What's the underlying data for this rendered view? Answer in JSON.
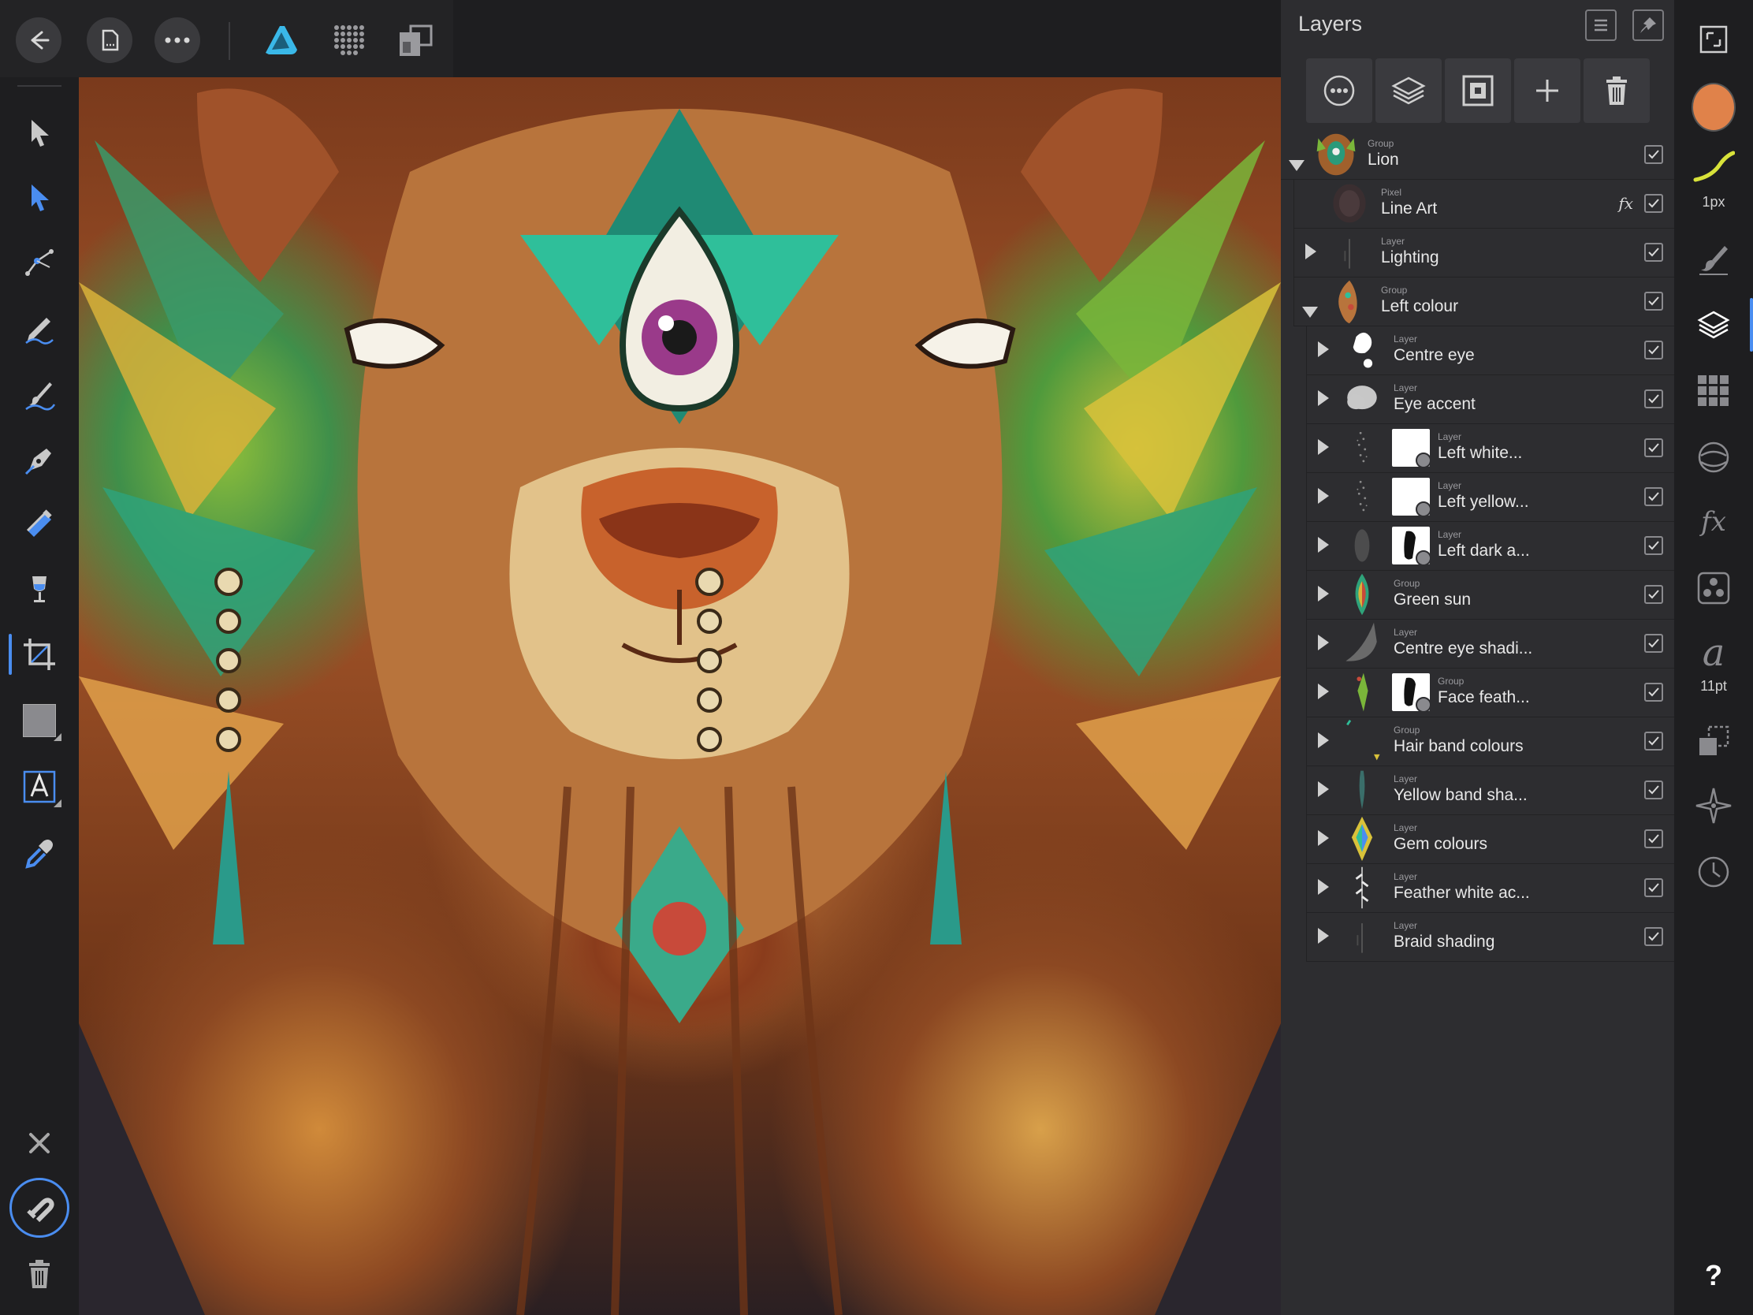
{
  "topbar": {
    "buttons": [
      {
        "name": "back-icon"
      },
      {
        "name": "document-icon"
      },
      {
        "name": "more-icon"
      },
      {
        "name": "designer-persona-icon"
      },
      {
        "name": "pixel-persona-icon"
      },
      {
        "name": "export-persona-icon"
      }
    ]
  },
  "tools": [
    {
      "name": "move-tool-icon"
    },
    {
      "name": "node-tool-icon"
    },
    {
      "name": "corner-tool-icon"
    },
    {
      "name": "pencil-tool-icon"
    },
    {
      "name": "vector-brush-tool-icon"
    },
    {
      "name": "pen-tool-icon"
    },
    {
      "name": "fill-tool-icon"
    },
    {
      "name": "transparency-tool-icon"
    },
    {
      "name": "crop-tool-icon"
    },
    {
      "name": "rectangle-tool-icon"
    },
    {
      "name": "artistic-text-tool-icon"
    },
    {
      "name": "color-picker-tool-icon"
    }
  ],
  "bottom_tools": [
    {
      "name": "close-icon"
    },
    {
      "name": "snapping-icon"
    },
    {
      "name": "delete-icon"
    }
  ],
  "layers_panel": {
    "title": "Layers",
    "toolbar": [
      {
        "name": "layer-options-icon"
      },
      {
        "name": "layer-stack-icon"
      },
      {
        "name": "mask-icon"
      },
      {
        "name": "add-layer-icon"
      },
      {
        "name": "delete-layer-icon"
      }
    ],
    "rows": [
      {
        "type": "Group",
        "name": "Lion",
        "expanded": true,
        "depth": 0,
        "thumb": "lion",
        "visible": true
      },
      {
        "type": "Pixel",
        "name": "Line Art",
        "depth": 1,
        "thumb": "lineart",
        "fx": "fx",
        "visible": true
      },
      {
        "type": "Layer",
        "name": "Lighting",
        "expanded": false,
        "depth": 1,
        "thumb": "faint",
        "visible": true,
        "accent": true
      },
      {
        "type": "Group",
        "name": "Left colour",
        "expanded": true,
        "depth": 1,
        "thumb": "colour",
        "visible": true
      },
      {
        "type": "Layer",
        "name": "Centre eye",
        "expanded": false,
        "depth": 2,
        "thumb": "whiteblob",
        "visible": true,
        "accent": true
      },
      {
        "type": "Layer",
        "name": "Eye accent",
        "expanded": false,
        "depth": 2,
        "thumb": "cloud",
        "visible": true
      },
      {
        "type": "Layer",
        "name": "Left white...",
        "expanded": false,
        "depth": 2,
        "thumb": "speckle",
        "mask": "white",
        "visible": true,
        "accent": true
      },
      {
        "type": "Layer",
        "name": "Left yellow...",
        "expanded": false,
        "depth": 2,
        "thumb": "speckle",
        "mask": "white",
        "visible": true
      },
      {
        "type": "Layer",
        "name": "Left dark a...",
        "expanded": false,
        "depth": 2,
        "thumb": "darkspeckle",
        "mask": "black",
        "visible": true
      },
      {
        "type": "Group",
        "name": "Green sun",
        "expanded": false,
        "depth": 2,
        "thumb": "greensun",
        "visible": true
      },
      {
        "type": "Layer",
        "name": "Centre eye shadi...",
        "expanded": false,
        "depth": 2,
        "thumb": "crescent",
        "visible": true,
        "accent": true
      },
      {
        "type": "Group",
        "name": "Face feath...",
        "expanded": false,
        "depth": 2,
        "thumb": "feather",
        "mask": "black",
        "visible": true
      },
      {
        "type": "Group",
        "name": "Hair band colours",
        "expanded": false,
        "depth": 2,
        "thumb": "bits",
        "visible": true
      },
      {
        "type": "Layer",
        "name": "Yellow band sha...",
        "expanded": false,
        "depth": 2,
        "thumb": "teal",
        "visible": true,
        "accent": true
      },
      {
        "type": "Layer",
        "name": "Gem colours",
        "expanded": false,
        "depth": 2,
        "thumb": "gems",
        "visible": true,
        "accent": true
      },
      {
        "type": "Layer",
        "name": "Feather white ac...",
        "expanded": false,
        "depth": 2,
        "thumb": "whitefeather",
        "visible": true,
        "accent": true
      },
      {
        "type": "Layer",
        "name": "Braid shading",
        "expanded": false,
        "depth": 2,
        "thumb": "faint",
        "visible": true,
        "accent": true
      }
    ]
  },
  "studio": {
    "brush_size": "1px",
    "font_size": "11pt",
    "color": "#e0824a",
    "help": "?",
    "icons": [
      {
        "name": "fullscreen-icon"
      },
      {
        "name": "color-swatch-icon"
      },
      {
        "name": "stroke-icon"
      },
      {
        "name": "brushes-icon"
      },
      {
        "name": "layers-icon"
      },
      {
        "name": "swatches-icon"
      },
      {
        "name": "appearance-icon"
      },
      {
        "name": "effects-icon"
      },
      {
        "name": "styles-icon"
      },
      {
        "name": "text-styles-icon"
      },
      {
        "name": "transform-icon"
      },
      {
        "name": "navigator-icon"
      },
      {
        "name": "history-icon"
      },
      {
        "name": "help-icon"
      }
    ]
  },
  "colors": {
    "accent_blue": "#4a8df0",
    "persona_teal": "#3ab8e8",
    "panel_bg": "#2d2d30"
  }
}
